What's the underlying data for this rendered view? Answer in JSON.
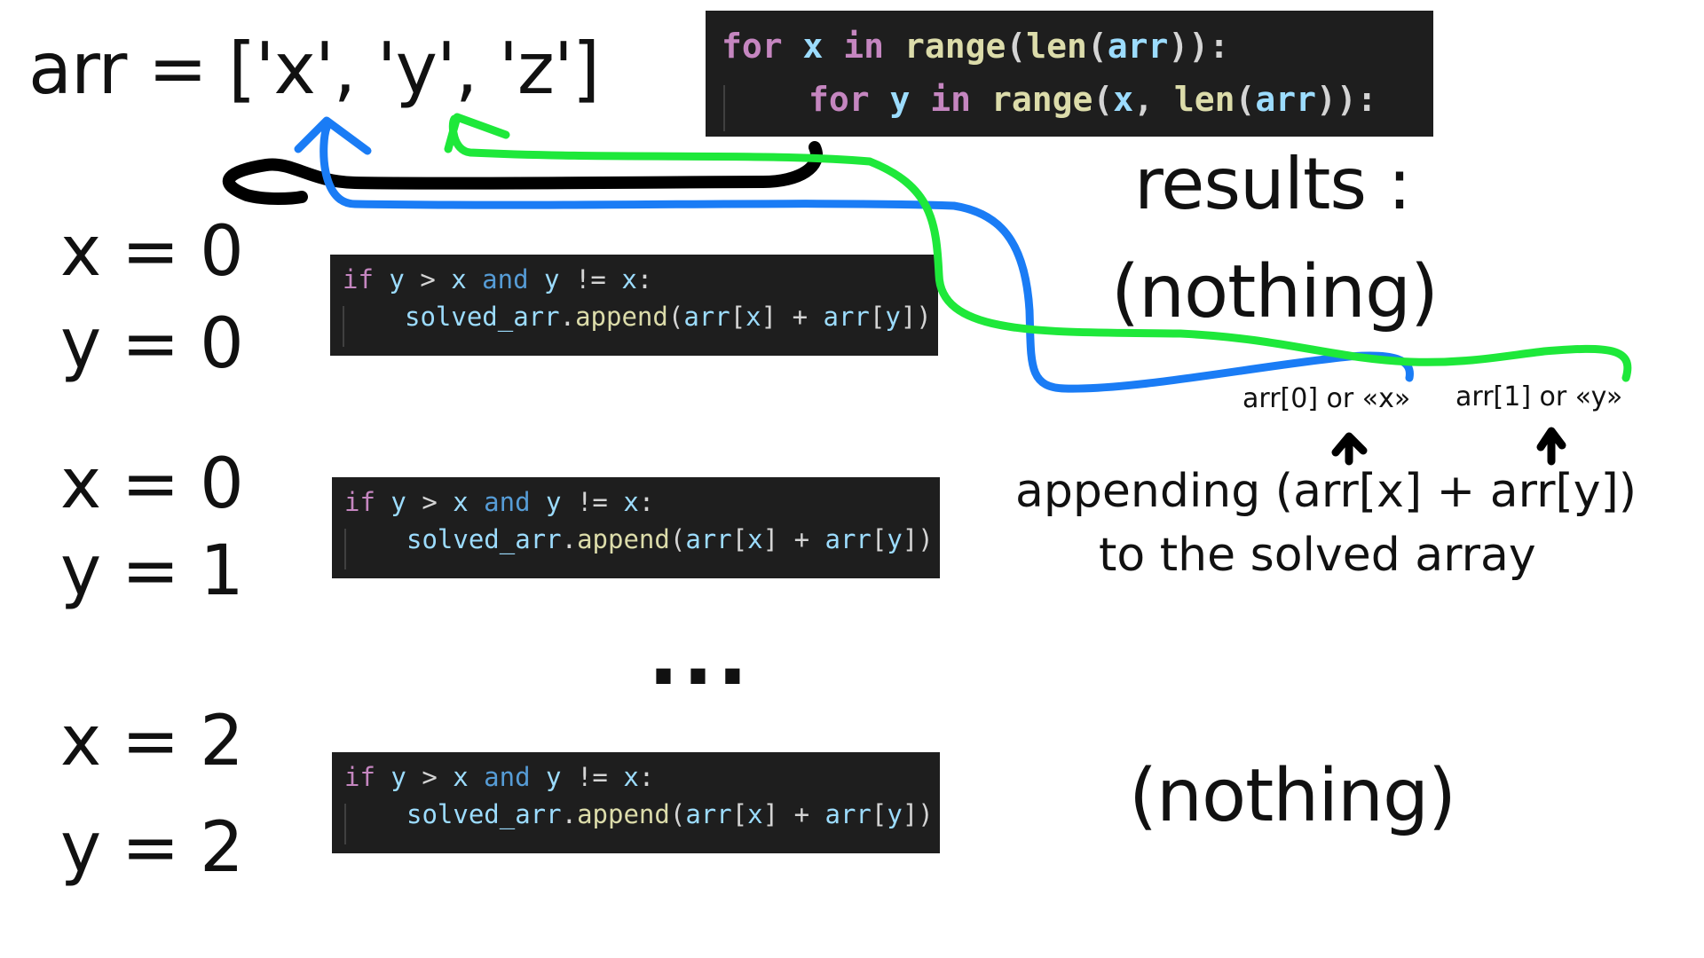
{
  "arr_declaration": "arr = ['x', 'y', 'z']",
  "top_code": {
    "line1": [
      {
        "t": "for",
        "c": "kw"
      },
      {
        "t": " x ",
        "c": "var"
      },
      {
        "t": "in",
        "c": "kw"
      },
      {
        "t": " ",
        "c": "plain"
      },
      {
        "t": "range",
        "c": "fn"
      },
      {
        "t": "(",
        "c": "plain"
      },
      {
        "t": "len",
        "c": "fn"
      },
      {
        "t": "(",
        "c": "plain"
      },
      {
        "t": "arr",
        "c": "var"
      },
      {
        "t": ")):",
        "c": "plain"
      }
    ],
    "line2": [
      {
        "t": "for",
        "c": "kw"
      },
      {
        "t": " y ",
        "c": "var"
      },
      {
        "t": "in",
        "c": "kw"
      },
      {
        "t": " ",
        "c": "plain"
      },
      {
        "t": "range",
        "c": "fn"
      },
      {
        "t": "(",
        "c": "plain"
      },
      {
        "t": "x",
        "c": "var"
      },
      {
        "t": ", ",
        "c": "plain"
      },
      {
        "t": "len",
        "c": "fn"
      },
      {
        "t": "(",
        "c": "plain"
      },
      {
        "t": "arr",
        "c": "var"
      },
      {
        "t": ")):",
        "c": "plain"
      }
    ]
  },
  "condition_code": {
    "line1": [
      {
        "t": "if",
        "c": "kw"
      },
      {
        "t": " y ",
        "c": "var"
      },
      {
        "t": ">",
        "c": "plain"
      },
      {
        "t": " x ",
        "c": "var"
      },
      {
        "t": "and",
        "c": "kw2"
      },
      {
        "t": " y ",
        "c": "var"
      },
      {
        "t": "!=",
        "c": "plain"
      },
      {
        "t": " x",
        "c": "var"
      },
      {
        "t": ":",
        "c": "plain"
      }
    ],
    "line2": [
      {
        "t": "solved_arr",
        "c": "var"
      },
      {
        "t": ".",
        "c": "plain"
      },
      {
        "t": "append",
        "c": "fn"
      },
      {
        "t": "(",
        "c": "plain"
      },
      {
        "t": "arr",
        "c": "var"
      },
      {
        "t": "[",
        "c": "plain"
      },
      {
        "t": "x",
        "c": "var"
      },
      {
        "t": "]",
        "c": "plain"
      },
      {
        "t": " + ",
        "c": "plain"
      },
      {
        "t": "arr",
        "c": "var"
      },
      {
        "t": "[",
        "c": "plain"
      },
      {
        "t": "y",
        "c": "var"
      },
      {
        "t": "])",
        "c": "plain"
      }
    ]
  },
  "iterations": [
    {
      "x_label": "x = 0",
      "y_label": "y = 0"
    },
    {
      "x_label": "x = 0",
      "y_label": "y = 1"
    },
    {
      "x_label": "x = 2",
      "y_label": "y = 2"
    }
  ],
  "ellipsis": "...",
  "results_title": "results :",
  "result_1": "(nothing)",
  "result_2": "(nothing)",
  "arr0_label": "arr[0] or «x»",
  "arr1_label": "arr[1] or «y»",
  "appending_line1": "appending (arr[x] + arr[y])",
  "appending_line2": "to the solved array",
  "colors": {
    "black_arrow": "#000000",
    "blue_arrow": "#1a7cf5",
    "green_arrow": "#1ee83a",
    "code_bg": "#1e1e1e"
  }
}
